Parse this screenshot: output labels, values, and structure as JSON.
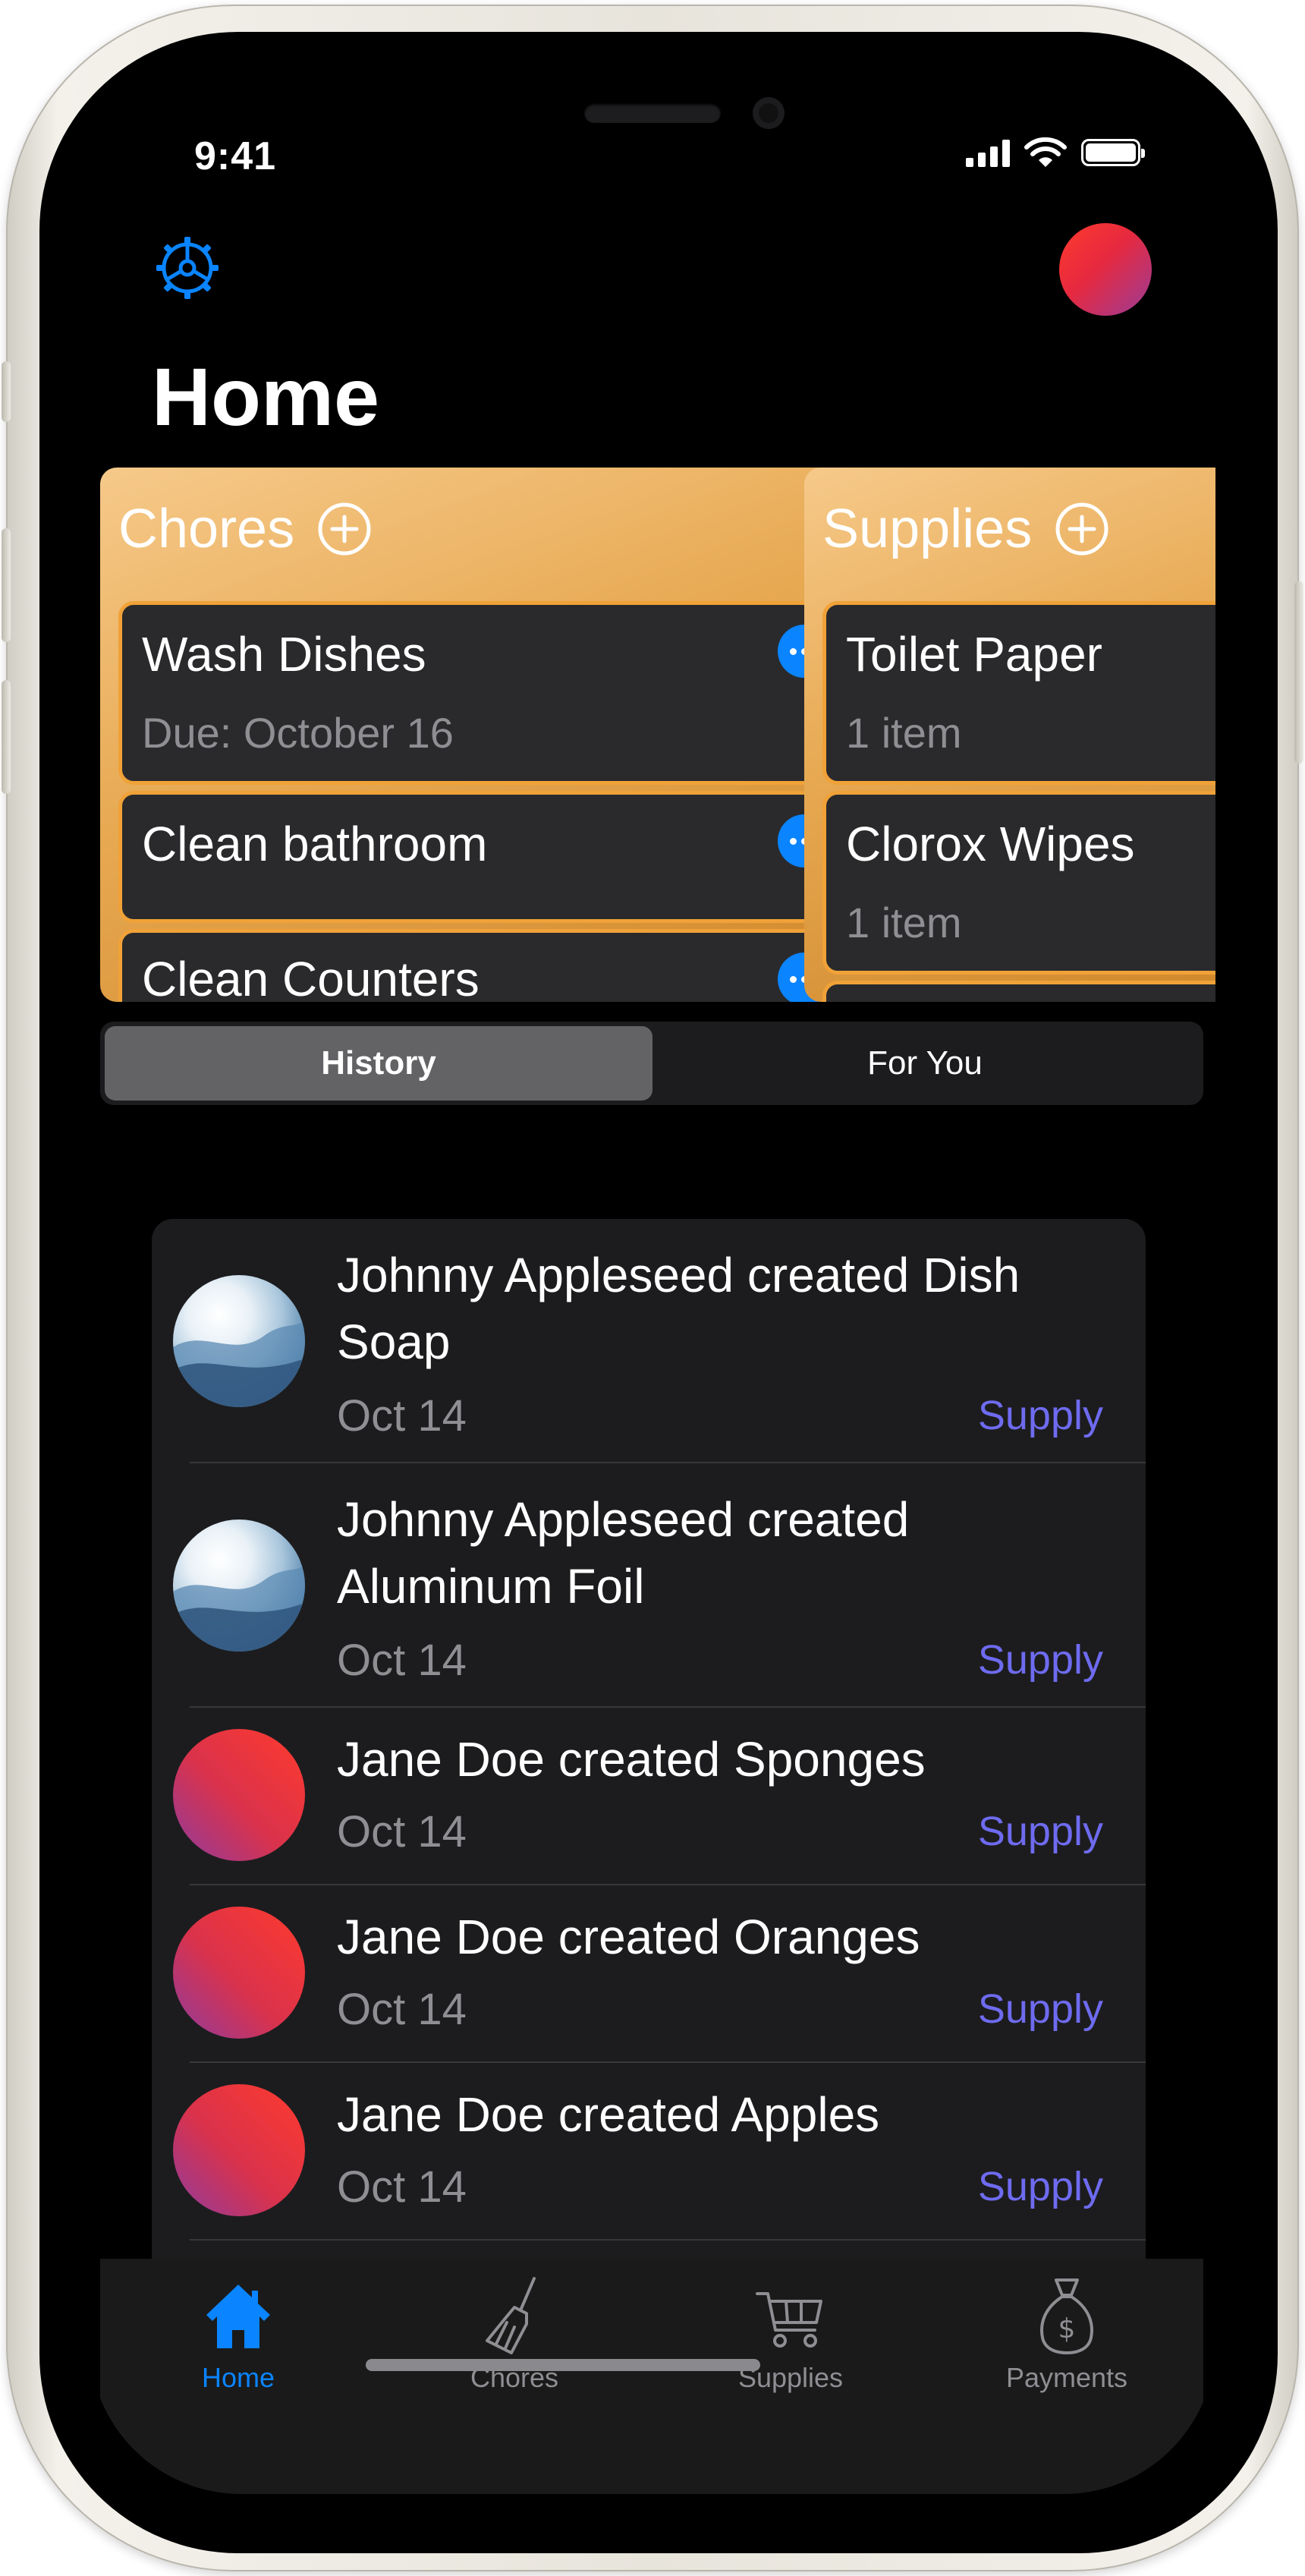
{
  "status": {
    "time": "9:41"
  },
  "header": {
    "title": "Home"
  },
  "cards": {
    "chores": {
      "title": "Chores",
      "items": [
        {
          "name": "Wash Dishes",
          "sub": "Due: October 16"
        },
        {
          "name": "Clean bathroom"
        },
        {
          "name": "Clean Counters"
        }
      ]
    },
    "supplies": {
      "title": "Supplies",
      "items": [
        {
          "name": "Toilet Paper",
          "sub": "1 item"
        },
        {
          "name": "Clorox Wipes",
          "sub": "1 item"
        }
      ]
    }
  },
  "segmented": {
    "selected": "History",
    "options": [
      "History",
      "For You"
    ]
  },
  "history": [
    {
      "title": "Johnny Appleseed created Dish Soap",
      "date": "Oct 14",
      "tag": "Supply",
      "avatar": "photo"
    },
    {
      "title": "Johnny Appleseed created Aluminum Foil",
      "date": "Oct 14",
      "tag": "Supply",
      "avatar": "photo"
    },
    {
      "title": "Jane Doe created Sponges",
      "date": "Oct 14",
      "tag": "Supply",
      "avatar": "gradient"
    },
    {
      "title": "Jane Doe created Oranges",
      "date": "Oct 14",
      "tag": "Supply",
      "avatar": "gradient"
    },
    {
      "title": "Jane Doe created Apples",
      "date": "Oct 14",
      "tag": "Supply",
      "avatar": "gradient"
    }
  ],
  "tabbar": {
    "selected": "Home",
    "tabs": [
      {
        "label": "Home",
        "icon": "house-icon"
      },
      {
        "label": "Chores",
        "icon": "broom-icon"
      },
      {
        "label": "Supplies",
        "icon": "cart-icon"
      },
      {
        "label": "Payments",
        "icon": "money-bag-icon"
      }
    ]
  },
  "colors": {
    "accent": "#0a84ff",
    "tag": "#6e6bf0",
    "card_gold": "#e7a952",
    "background": "#000000"
  }
}
